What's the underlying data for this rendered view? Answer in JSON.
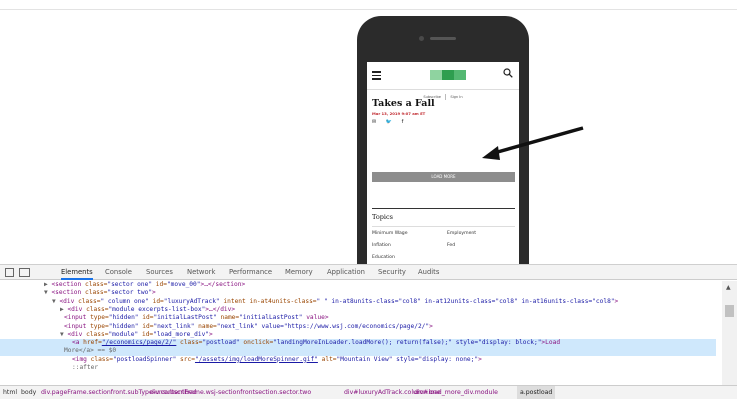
{
  "preview": {
    "nav": {
      "subscribe": "Subscribe",
      "signin": "Sign In"
    },
    "article": {
      "headline": "Takes a Fall",
      "dateline": "Mar 13, 2019 9:07 am ET",
      "share_icons": "✉ 🐦 f"
    },
    "load_more": "LOAD MORE",
    "topics_heading": "Topics",
    "topics": [
      "Minimum Wage",
      "Employment",
      "Inflation",
      "Fed",
      "Education"
    ],
    "colors": {
      "logo_green": "#2e9e4f",
      "dateline_red": "#c0272d",
      "loadmore_gray": "#8d8d8d"
    }
  },
  "devtools": {
    "tabs": [
      "Elements",
      "Console",
      "Sources",
      "Network",
      "Performance",
      "Memory",
      "Application",
      "Security",
      "Audits"
    ],
    "code": [
      {
        "p": "▶",
        "tag": "<section",
        "a1": " class=",
        "v1": "\"sector one\"",
        "a2": " id=",
        "v2": "\"move_00\"",
        "rest": ">…</section>"
      },
      {
        "p": "▼",
        "tag": "<section",
        "a1": " class=",
        "v1": "\"sector two\"",
        "rest": ">"
      },
      {
        "p": "▼",
        "tag": "<div",
        "a1": " class=",
        "v1": "\" column one\"",
        "a2": " id=",
        "v2": "\"luxuryAdTrack\"",
        "a3": " intent in-at4units-class=",
        "v3": "\" \" in-at8units-class=\"col8\" in-at12units-class=\"col8\" in-at16units-class=\"col8\"",
        "rest": ">"
      },
      {
        "p": "▶",
        "tag": "<div",
        "a1": " class=",
        "v1": "\"module excerpts-list-box\"",
        "rest": ">…</div>"
      },
      {
        "p": "",
        "tag": "<input",
        "a1": " type=",
        "v1": "\"hidden\"",
        "a2": " id=",
        "v2": "\"initialLastPost\"",
        "a3": " name=",
        "v3": "\"initialLastPost\"",
        "rest": " value>"
      },
      {
        "p": "",
        "tag": "<input",
        "a1": " type=",
        "v1": "\"hidden\"",
        "a2": " id=",
        "v2": "\"next_link\"",
        "a3": " name=",
        "v3": "\"next_link\" value=\"https://www.wsj.com/economics/page/2/\"",
        "rest": ">"
      },
      {
        "p": "▼",
        "tag": "<div",
        "a1": " class=",
        "v1": "\"module\"",
        "a2": " id=",
        "v2": "\"load_more_div\"",
        "rest": ">"
      },
      {
        "p": "",
        "tag": "<a",
        "a1": " href=",
        "v1": "\"/economics/page/2/\"",
        "a2": " class=",
        "v2": "\"postload\"",
        "a3": " onclick=",
        "v3": "\"landingMoreInLoader.loadMore(); return(false);\" style=\"display: block;\"",
        "rest": ">Load"
      },
      {
        "p": "",
        "tag": "",
        "rest": "More</a> == $0"
      },
      {
        "p": "",
        "tag": "<img",
        "a1": " class=",
        "v1": "\"postloadSpinner\"",
        "a2": " src=",
        "v2": "\"/assets/img/loadMoreSpinner.gif\"",
        "a3": " alt=",
        "v3": "\"Mountain View\" style=\"display: none;\"",
        "rest": ">"
      },
      {
        "p": "",
        "tag": "",
        "rest": "::after"
      }
    ],
    "breadcrumbs": [
      "html",
      "body",
      "div.pageFrame.sectionfront.subType-unsubscribed",
      "div.contentFrame.wsj-sectionfront",
      "section.sector.two",
      "div#luxuryAdTrack.column.one",
      "div#load_more_div.module",
      "a.postload"
    ]
  }
}
